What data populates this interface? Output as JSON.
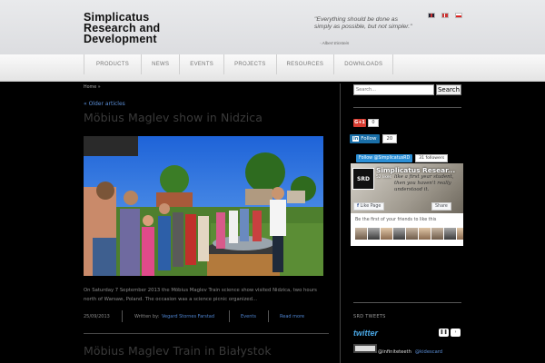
{
  "header": {
    "logo_line1": "Simplicatus",
    "logo_line2": "Research and",
    "logo_line3": "Development",
    "quote": "\"Everything should be done as simply as possible, but not simpler.\"",
    "quote_author": "- Albert Einstein",
    "flags": [
      "gb-flag",
      "no-flag",
      "pl-flag"
    ]
  },
  "nav": {
    "items": [
      "PRODUCTS",
      "NEWS",
      "EVENTS",
      "PROJECTS",
      "RESOURCES",
      "DOWNLOADS"
    ]
  },
  "main": {
    "breadcrumb": "Home  »",
    "older_articles": "« Older articles",
    "post1": {
      "title": "Möbius Maglev show in Nidzica",
      "excerpt": "On Saturday 7 September 2013 the Möbius Maglev Train science show visited Nidzica, two hours north of Warsaw, Poland. The occasion was a science picnic organized...",
      "date": "25/09/2013",
      "written_by": "Written by:",
      "author": "Vegard Stornes Farstad",
      "category": "Events",
      "read_more": "Read more"
    },
    "post2": {
      "title": "Möbius Maglev Train in Białystok"
    }
  },
  "sidebar": {
    "search_placeholder": "Search...",
    "search_button": "Search",
    "gplus_label": "G+1",
    "gplus_count": "0",
    "linkedin_label": "Follow",
    "linkedin_count": "20",
    "twitter_follow": "Follow @SimplicatusRD",
    "twitter_followers": "31 followers",
    "fb_page_name": "Simplicatus Resear...",
    "fb_likes": "52 likes",
    "fb_cover_text": "like a first year student, then you haven't really understood it.",
    "fb_like_page": "Like Page",
    "fb_share": "Share",
    "fb_friends_text": "Be the first of your friends to like this",
    "srd_tweets_heading": "SRD TWEETS",
    "twitter_logo": "twitter",
    "tweet_handle1": "@infiniteteeth",
    "tweet_handle2": "@kidescard"
  },
  "colors": {
    "background": "#000000",
    "link": "#4e84d0",
    "title": "#3a3a3a"
  }
}
